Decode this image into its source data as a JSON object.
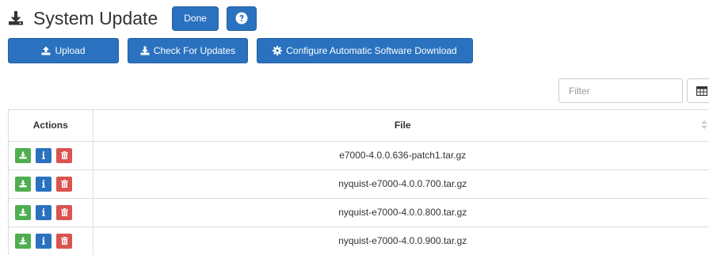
{
  "header": {
    "title": "System Update",
    "done_label": "Done",
    "icon": "download-icon",
    "help_icon": "question-circle-icon"
  },
  "toolbar": {
    "upload_label": "Upload",
    "check_label": "Check For Updates",
    "config_label": "Configure Automatic Software Download"
  },
  "filter": {
    "placeholder": "Filter"
  },
  "table": {
    "headers": {
      "actions": "Actions",
      "file": "File"
    },
    "rows": [
      {
        "file": "e7000-4.0.0.636-patch1.tar.gz"
      },
      {
        "file": "nyquist-e7000-4.0.0.700.tar.gz"
      },
      {
        "file": "nyquist-e7000-4.0.0.800.tar.gz"
      },
      {
        "file": "nyquist-e7000-4.0.0.900.tar.gz"
      }
    ]
  },
  "colors": {
    "primary": "#2a72bf",
    "success": "#4fae4f",
    "danger": "#d9534f"
  }
}
